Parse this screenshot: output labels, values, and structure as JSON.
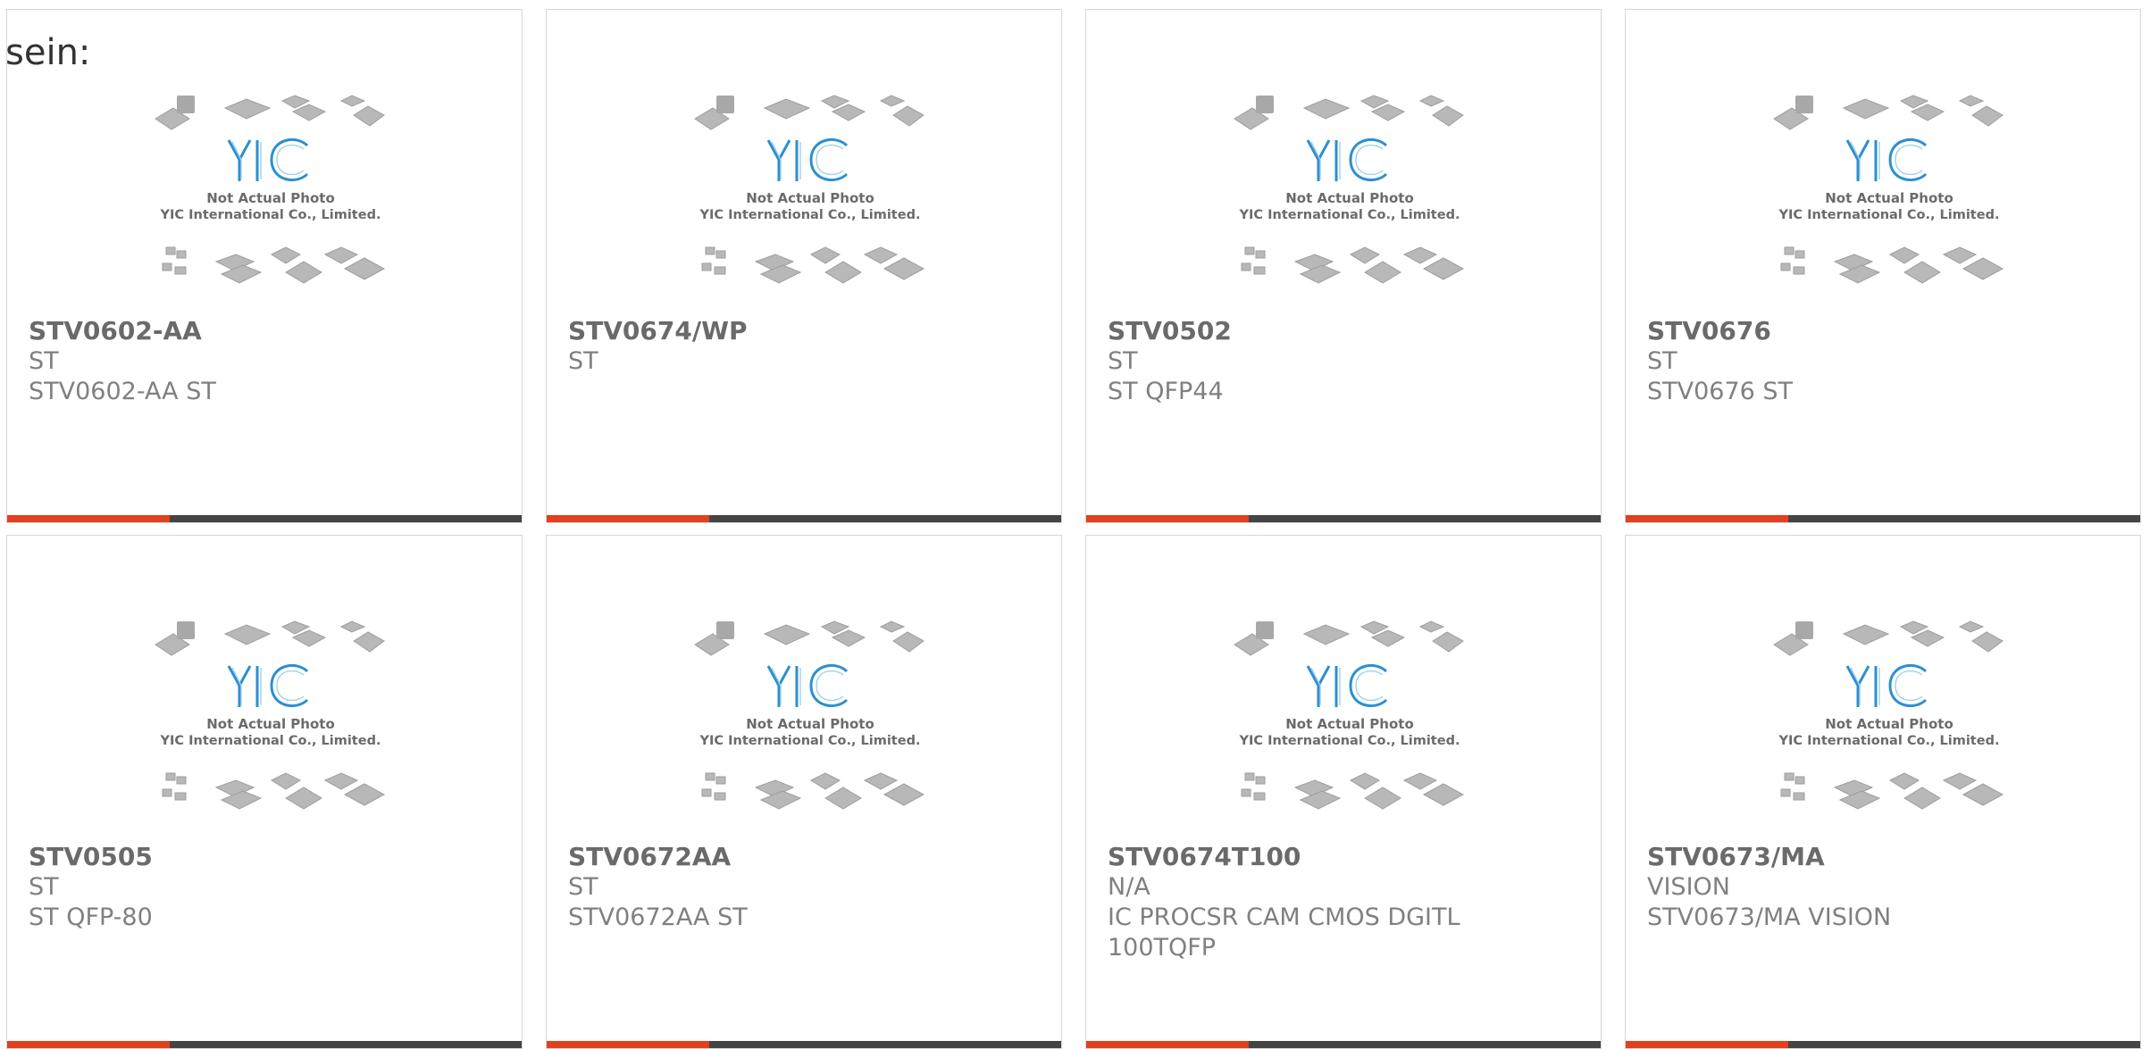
{
  "header": {
    "text": "sein:"
  },
  "thumbnail": {
    "line1": "Not Actual Photo",
    "line2": "YIC International Co., Limited.",
    "logo_text": "YIC"
  },
  "colors": {
    "accent": "#e2401f",
    "bar": "#444444",
    "logo": "#2d8fd2"
  },
  "products": [
    {
      "part": "STV0602-AA",
      "maker": "ST",
      "desc": "STV0602-AA ST",
      "desc2": ""
    },
    {
      "part": "STV0674/WP",
      "maker": "ST",
      "desc": "",
      "desc2": ""
    },
    {
      "part": "STV0502",
      "maker": "ST",
      "desc": "ST QFP44",
      "desc2": ""
    },
    {
      "part": "STV0676",
      "maker": "ST",
      "desc": "STV0676 ST",
      "desc2": ""
    },
    {
      "part": "STV0505",
      "maker": "ST",
      "desc": "ST QFP-80",
      "desc2": ""
    },
    {
      "part": "STV0672AA",
      "maker": "ST",
      "desc": "STV0672AA ST",
      "desc2": ""
    },
    {
      "part": "STV0674T100",
      "maker": "N/A",
      "desc": "IC PROCSR CAM CMOS DGITL",
      "desc2": "100TQFP"
    },
    {
      "part": "STV0673/MA",
      "maker": "VISION",
      "desc": "STV0673/MA VISION",
      "desc2": ""
    }
  ]
}
